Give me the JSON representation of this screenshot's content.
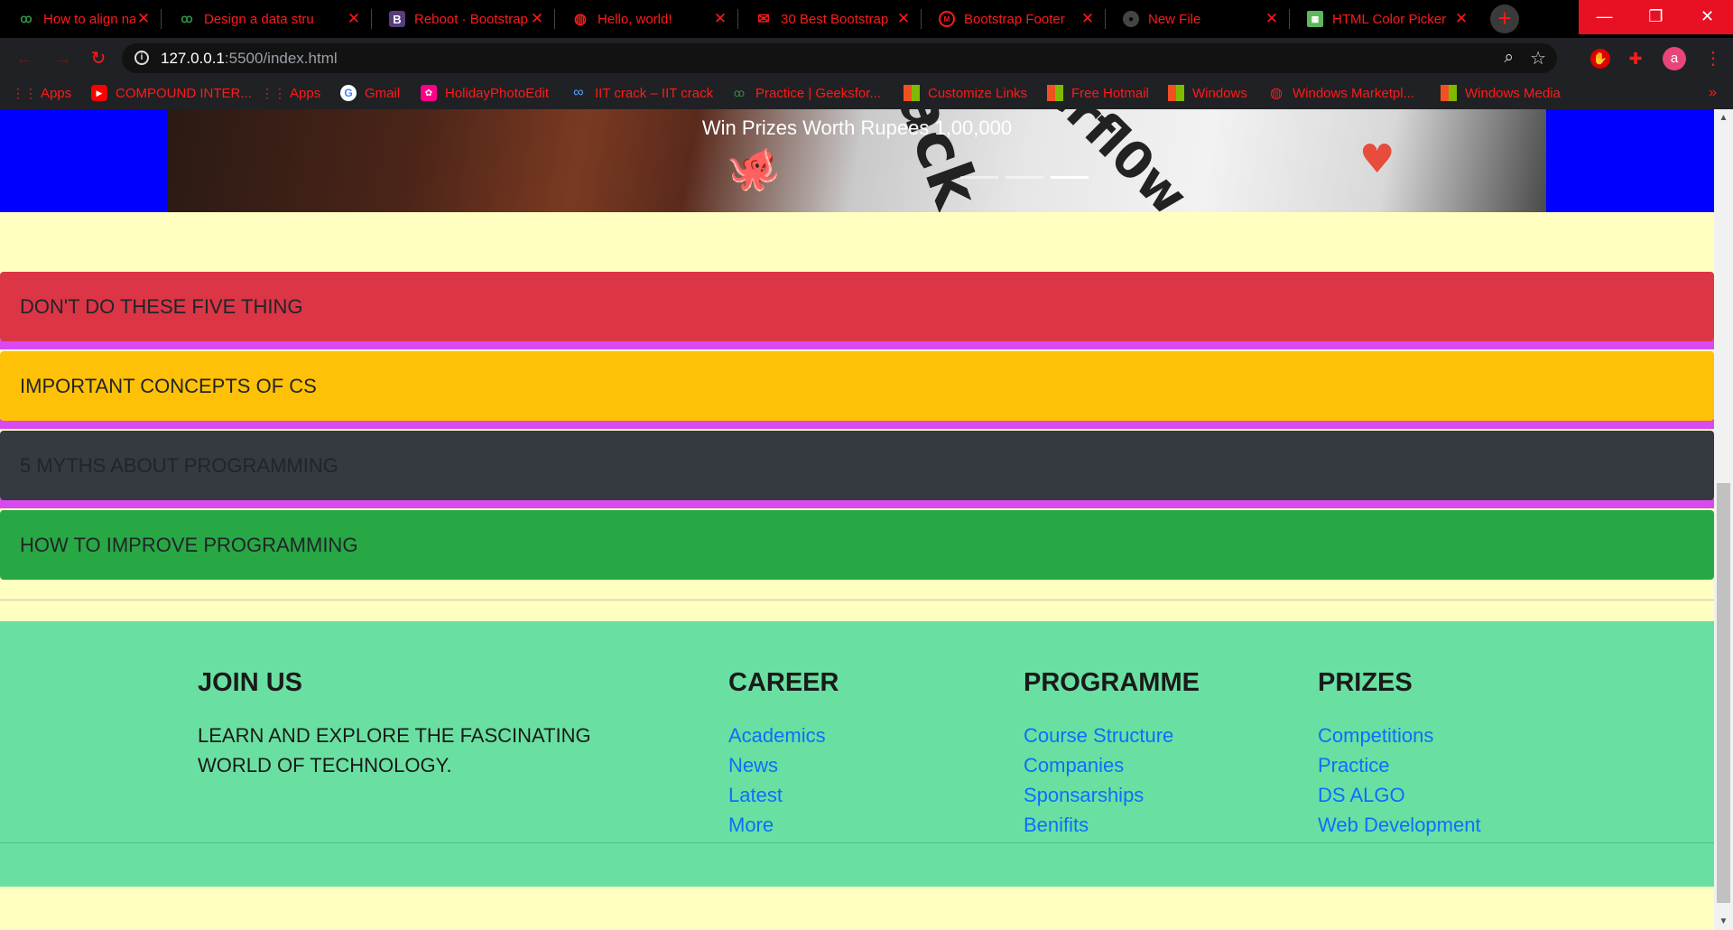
{
  "browser": {
    "tabs": [
      {
        "title": "How to align navb",
        "icon": "geeksforgeeks-icon"
      },
      {
        "title": "Design a data stru",
        "icon": "geeksforgeeks-icon"
      },
      {
        "title": "Reboot · Bootstrap",
        "icon": "bootstrap-icon",
        "icon_char": "B"
      },
      {
        "title": "Hello, world!",
        "icon": "globe-icon"
      },
      {
        "title": "30 Best Bootstrap",
        "icon": "mail-icon"
      },
      {
        "title": "Bootstrap Footer",
        "icon": "mdb-icon"
      },
      {
        "title": "New File",
        "icon": "github-icon"
      },
      {
        "title": "HTML Color Picker",
        "icon": "color-picker-icon"
      }
    ],
    "url_host": "127.0.0.1",
    "url_path": ":5500/index.html",
    "profile_initial": "a",
    "bookmarks": [
      {
        "label": "Apps",
        "icon": "apps-grid-icon"
      },
      {
        "label": "COMPOUND INTER...",
        "icon": "youtube-icon"
      },
      {
        "label": "Apps",
        "icon": "apps-grid-icon"
      },
      {
        "label": "Gmail",
        "icon": "google-icon"
      },
      {
        "label": "HolidayPhotoEdit",
        "icon": "photo-edit-icon"
      },
      {
        "label": "IIT crack – IIT crack",
        "icon": "infinity-icon"
      },
      {
        "label": "Practice | Geeksfor...",
        "icon": "geeksforgeeks-icon"
      },
      {
        "label": "Customize Links",
        "icon": "windows-icon"
      },
      {
        "label": "Free Hotmail",
        "icon": "windows-icon"
      },
      {
        "label": "Windows",
        "icon": "windows-icon"
      },
      {
        "label": "Windows Marketpl...",
        "icon": "globe-icon"
      },
      {
        "label": "Windows Media",
        "icon": "windows-icon"
      }
    ],
    "more_bookmarks": "»"
  },
  "carousel": {
    "caption": "Win Prizes Worth Rupees 1,00,000",
    "slides_count": 3,
    "active_slide": 3
  },
  "bars": [
    {
      "label": "DON'T DO THESE FIVE THING",
      "bg": "#dc3545",
      "fg": "#212529"
    },
    {
      "label": "IMPORTANT CONCEPTS OF CS",
      "bg": "#ffc107",
      "fg": "#212529"
    },
    {
      "label": "5 MYTHS ABOUT PROGRAMMING",
      "bg": "#343a40",
      "fg": "#212529"
    },
    {
      "label": "HOW TO IMPROVE PROGRAMMING",
      "bg": "#28a745",
      "fg": "#212529"
    }
  ],
  "footer": {
    "join": {
      "heading": "JOIN US",
      "text": "LEARN AND EXPLORE THE FASCINATING WORLD OF TECHNOLOGY."
    },
    "career": {
      "heading": "CAREER",
      "links": [
        "Academics",
        "News",
        "Latest",
        "More"
      ]
    },
    "programme": {
      "heading": "PROGRAMME",
      "links": [
        "Course Structure",
        "Companies",
        "Sponsarships",
        "Benifits"
      ]
    },
    "prizes": {
      "heading": "PRIZES",
      "links": [
        "Competitions",
        "Practice",
        "DS ALGO",
        "Web Development"
      ]
    }
  },
  "colors": {
    "page_bg": "#ffffc2",
    "carousel_band": "#0000ff",
    "bar_gap": "#d94af0",
    "footer_bg": "#69e0a2",
    "link": "#0d6efd",
    "chrome_accent": "#ff1a1a"
  }
}
